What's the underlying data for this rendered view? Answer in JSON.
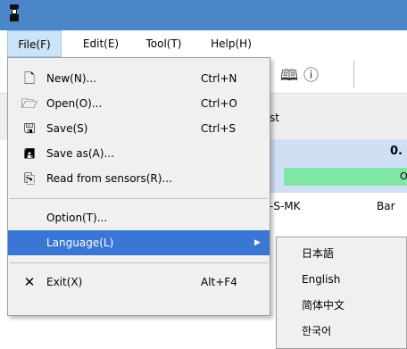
{
  "menubar": {
    "file": "File(F)",
    "edit": "Edit(E)",
    "tool": "Tool(T)",
    "help": "Help(H)"
  },
  "toolbar": {
    "icons": [
      "manual-book-icon",
      "info-icon"
    ],
    "book_glyph": "🕮",
    "info_glyph": "ⓘ"
  },
  "background": {
    "tab_fragment": "st",
    "value_fragment": "0.",
    "status_fragment": "O",
    "row_text_1": "-S-MK",
    "row_text_2": "Bar"
  },
  "file_menu": {
    "items": [
      {
        "label": "New(N)...",
        "shortcut": "Ctrl+N",
        "icon": "new-file-icon",
        "glyph": "🗋"
      },
      {
        "label": "Open(O)...",
        "shortcut": "Ctrl+O",
        "icon": "open-folder-icon",
        "glyph": "🗁"
      },
      {
        "label": "Save(S)",
        "shortcut": "Ctrl+S",
        "icon": "save-icon",
        "glyph": "🖫"
      },
      {
        "label": "Save as(A)...",
        "shortcut": "",
        "icon": "save-as-icon",
        "glyph": "🖪"
      },
      {
        "label": "Read from sensors(R)...",
        "shortcut": "",
        "icon": "read-sensors-icon",
        "glyph": "⎘"
      },
      {
        "label": "Option(T)...",
        "shortcut": ""
      },
      {
        "label": "Language(L)",
        "shortcut": "",
        "submenu_arrow": "▶"
      },
      {
        "label": "Exit(X)",
        "shortcut": "Alt+F4",
        "icon": "close-icon",
        "glyph": "✕"
      }
    ]
  },
  "language_menu": {
    "items": [
      "日本語",
      "English",
      "简体中文",
      "한국어"
    ]
  },
  "colors": {
    "titlebar": "#4a86c8",
    "highlight": "#3a77d4",
    "menubar_active": "#cce4f7",
    "panel_blue": "#cfe0f5",
    "panel_green": "#7fe6a6"
  }
}
